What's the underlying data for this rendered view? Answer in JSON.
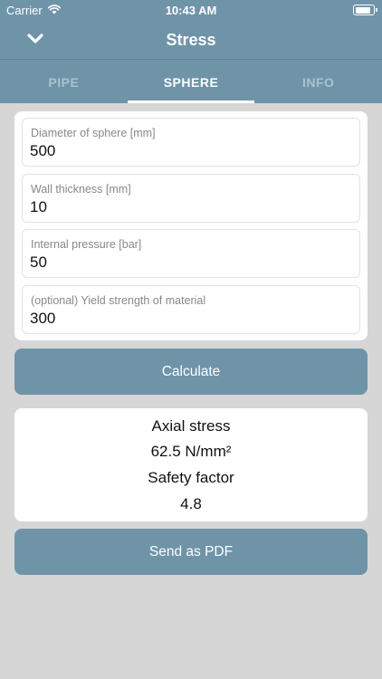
{
  "status_bar": {
    "carrier": "Carrier",
    "time": "10:43 AM"
  },
  "nav": {
    "title": "Stress",
    "back_icon": "chevron-down-icon"
  },
  "tabs": [
    {
      "label": "PIPE",
      "active": false
    },
    {
      "label": "SPHERE",
      "active": true
    },
    {
      "label": "INFO",
      "active": false
    }
  ],
  "form": {
    "fields": [
      {
        "label": "Diameter of sphere [mm]",
        "value": "500"
      },
      {
        "label": "Wall thickness [mm]",
        "value": "10"
      },
      {
        "label": "Internal pressure [bar]",
        "value": "50"
      },
      {
        "label": "(optional) Yield strength of material",
        "value": "300"
      }
    ]
  },
  "buttons": {
    "calculate": "Calculate",
    "send_pdf": "Send as PDF"
  },
  "results": {
    "stress_label": "Axial stress",
    "stress_value": "62.5 N/mm²",
    "safety_label": "Safety factor",
    "safety_value": "4.8"
  },
  "colors": {
    "accent": "#6f94a8",
    "background": "#d6d6d6",
    "tab_inactive": "#a9c2cf"
  }
}
